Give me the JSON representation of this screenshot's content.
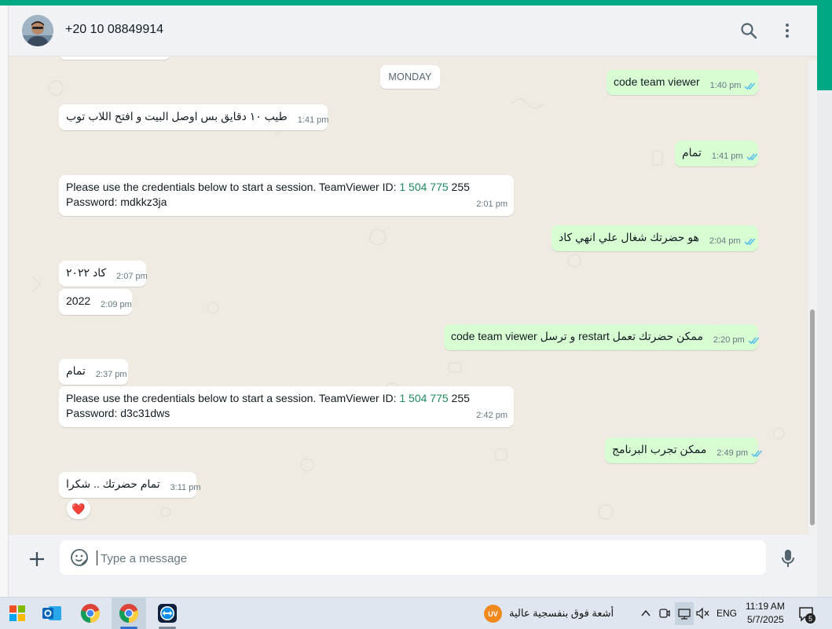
{
  "header": {
    "contact_name": "+20 10 08849914"
  },
  "chat": {
    "day_divider": "MONDAY",
    "messages": [
      {
        "direction": "out",
        "text": "code team viewer",
        "time": "1:40 pm",
        "ticks": "read"
      },
      {
        "direction": "in",
        "text": "طيب ١٠ دقايق بس اوصل البيت و افتح اللاب توب",
        "time": "1:41 pm"
      },
      {
        "direction": "out",
        "text": "تمام",
        "time": "1:41 pm",
        "ticks": "read"
      },
      {
        "direction": "in",
        "text_line1": "Please use the credentials below to start a session. TeamViewer ID: ",
        "id_link": "1 504 775",
        "id_tail": " 255",
        "text_line2": "Password: mdkkz3ja",
        "time": "2:01 pm"
      },
      {
        "direction": "out",
        "text": "هو حضرتك شغال علي انهي كاد",
        "time": "2:04 pm",
        "ticks": "read"
      },
      {
        "direction": "in",
        "text": "كاد ٢٠٢٢",
        "time": "2:07 pm"
      },
      {
        "direction": "in",
        "text": "2022",
        "time": "2:09 pm"
      },
      {
        "direction": "out",
        "text": "ممكن حضرتك تعمل restart و ترسل code team viewer",
        "time": "2:20 pm",
        "ticks": "read"
      },
      {
        "direction": "in",
        "text": "تمام",
        "time": "2:37 pm"
      },
      {
        "direction": "in",
        "text_line1": "Please use the credentials below to start a session. TeamViewer ID: ",
        "id_link": "1 504 775",
        "id_tail": " 255",
        "text_line2": "Password: d3c31dws",
        "time": "2:42 pm"
      },
      {
        "direction": "out",
        "text": "ممكن تجرب البرنامج",
        "time": "2:49 pm",
        "ticks": "read"
      },
      {
        "direction": "in",
        "text": "تمام حضرتك .. شكرا",
        "time": "3:11 pm",
        "reaction": "❤️"
      }
    ]
  },
  "composer": {
    "placeholder": "Type a message"
  },
  "taskbar": {
    "weather_badge": "UV",
    "weather_text": "أشعة فوق بنفسجية عالية",
    "language": "ENG",
    "time": "11:19 AM",
    "date": "5/7/2025",
    "notification_count": "5"
  },
  "colors": {
    "accent": "#00a884",
    "outgoing_bubble": "#d9fdd3",
    "incoming_bubble": "#ffffff",
    "chat_background": "#efeae2",
    "read_tick": "#53bdeb"
  }
}
